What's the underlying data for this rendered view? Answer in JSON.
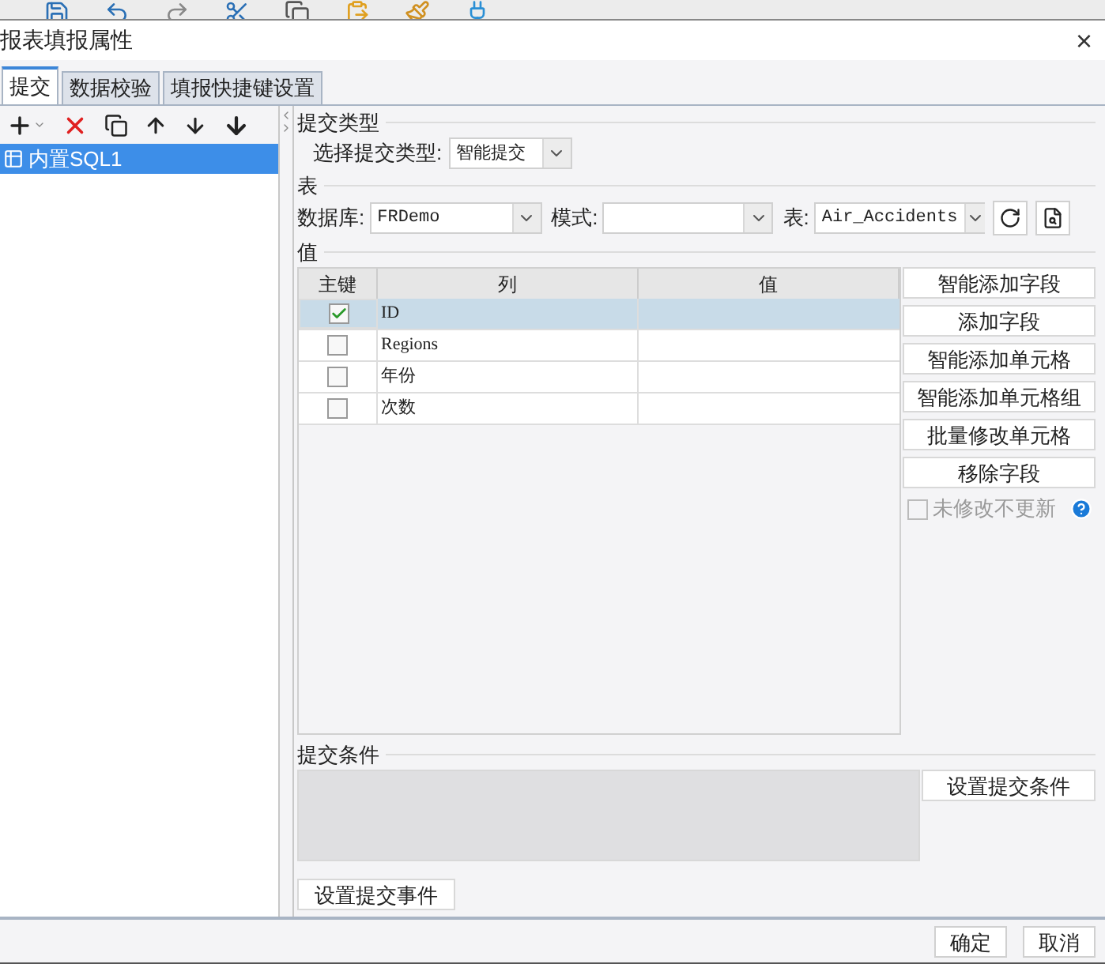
{
  "dialog": {
    "title": "报表填报属性",
    "close": "×"
  },
  "tabs": [
    {
      "label": "提交",
      "selected": true
    },
    {
      "label": "数据校验",
      "selected": false
    },
    {
      "label": "填报快捷键设置",
      "selected": false
    }
  ],
  "datasets": [
    {
      "label": "内置SQL1",
      "selected": true
    }
  ],
  "submit_type": {
    "heading": "提交类型",
    "label": "选择提交类型:",
    "value": "智能提交"
  },
  "table_section": {
    "heading": "表",
    "database_label": "数据库:",
    "database": "FRDemo",
    "schema_label": "模式:",
    "table_label": "表:",
    "table": "Air_Accidents"
  },
  "values": {
    "heading": "值",
    "columns": [
      "主键",
      "列",
      "值"
    ],
    "rows": [
      {
        "key": true,
        "column": "ID",
        "selected": true
      },
      {
        "key": false,
        "column": "Regions",
        "selected": false
      },
      {
        "key": false,
        "column": "年份",
        "selected": false
      },
      {
        "key": false,
        "column": "次数",
        "selected": false
      }
    ],
    "buttons": [
      "智能添加字段",
      "添加字段",
      "智能添加单元格",
      "智能添加单元格组",
      "批量修改单元格",
      "移除字段"
    ],
    "no_update": {
      "label": "未修改不更新",
      "checked": false,
      "disabled": true
    }
  },
  "condition": {
    "heading": "提交条件",
    "button": "设置提交条件"
  },
  "event_button": "设置提交事件",
  "footer": [
    "确定",
    "取消"
  ]
}
